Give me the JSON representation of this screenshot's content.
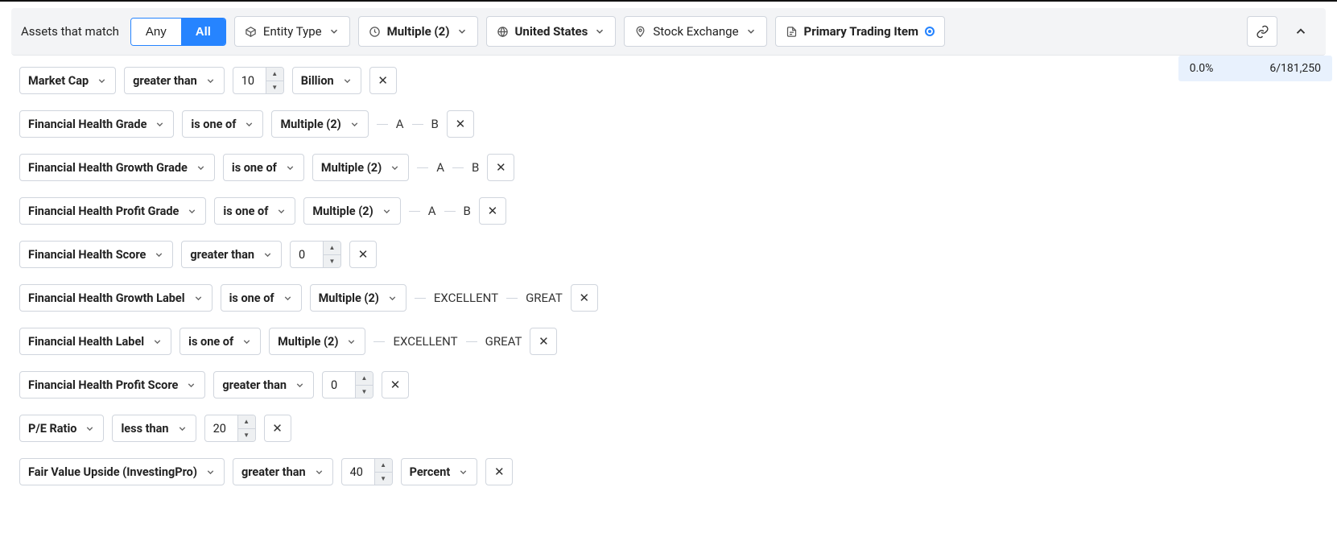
{
  "topbar": {
    "label": "Assets that match",
    "toggle": {
      "any": "Any",
      "all": "All",
      "active": "all"
    },
    "entity_type": "Entity Type",
    "multiple": "Multiple (2)",
    "country": "United States",
    "exchange": "Stock Exchange",
    "primary": "Primary Trading Item"
  },
  "stats": {
    "pct": "0.0%",
    "count": "6/181,250"
  },
  "rows": [
    {
      "metric": "Market Cap",
      "op": "greater than",
      "value": "10",
      "unit": "Billion"
    },
    {
      "metric": "Financial Health Grade",
      "op": "is one of",
      "multi": "Multiple (2)",
      "tags": [
        "A",
        "B"
      ]
    },
    {
      "metric": "Financial Health Growth Grade",
      "op": "is one of",
      "multi": "Multiple (2)",
      "tags": [
        "A",
        "B"
      ]
    },
    {
      "metric": "Financial Health Profit Grade",
      "op": "is one of",
      "multi": "Multiple (2)",
      "tags": [
        "A",
        "B"
      ]
    },
    {
      "metric": "Financial Health Score",
      "op": "greater than",
      "value": "0"
    },
    {
      "metric": "Financial Health Growth Label",
      "op": "is one of",
      "multi": "Multiple (2)",
      "tags": [
        "EXCELLENT",
        "GREAT"
      ]
    },
    {
      "metric": "Financial Health Label",
      "op": "is one of",
      "multi": "Multiple (2)",
      "tags": [
        "EXCELLENT",
        "GREAT"
      ]
    },
    {
      "metric": "Financial Health Profit Score",
      "op": "greater than",
      "value": "0"
    },
    {
      "metric": "P/E Ratio",
      "op": "less than",
      "value": "20"
    },
    {
      "metric": "Fair Value Upside (InvestingPro)",
      "op": "greater than",
      "value": "40",
      "unit": "Percent"
    }
  ]
}
